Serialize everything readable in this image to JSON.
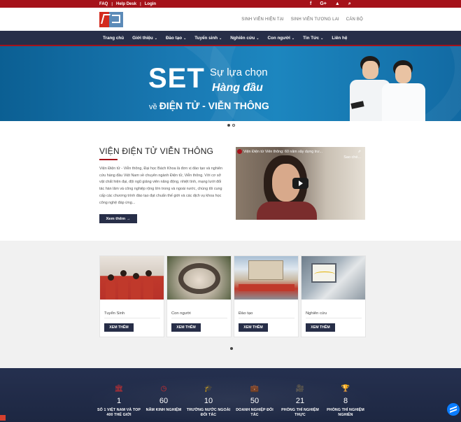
{
  "topbar": {
    "links": [
      "FAQ",
      "Help Desk",
      "Login"
    ],
    "separator": "|",
    "social_icons": [
      "facebook-icon",
      "google-plus-icon",
      "user-icon",
      "search-icon"
    ],
    "social_glyphs": [
      "f",
      "G+",
      "▲",
      "⌕"
    ]
  },
  "header": {
    "nav": [
      "SINH VIÊN HIỆN TẠI",
      "SINH VIÊN TƯƠNG LAI",
      "CÁN BỘ"
    ]
  },
  "mainnav": {
    "items": [
      {
        "label": "Trang chủ",
        "dropdown": false
      },
      {
        "label": "Giới thiệu",
        "dropdown": true
      },
      {
        "label": "Đào tạo",
        "dropdown": true
      },
      {
        "label": "Tuyển sinh",
        "dropdown": true
      },
      {
        "label": "Nghiên cứu",
        "dropdown": true
      },
      {
        "label": "Con người",
        "dropdown": true
      },
      {
        "label": "Tin Tức",
        "dropdown": true
      },
      {
        "label": "Liên hệ",
        "dropdown": false
      }
    ],
    "caret": "⌄"
  },
  "hero": {
    "set": "SET",
    "choice": "Sự lựa chọn",
    "top": "Hàng đầu",
    "ve": "về",
    "field": "ĐIỆN TỬ - VIỄN THÔNG",
    "slides": 2,
    "active_slide": 0
  },
  "about": {
    "title": "VIỆN ĐIỆN TỬ VIỄN THÔNG",
    "text": "Viện Điện tử - Viễn thông, Đại học Bách Khoa là đơn vị đào tạo và nghiên cứu hàng đầu Việt Nam về chuyên ngành Điện tử, Viễn thông. Với cơ sở vật chất hiện đại, đội ngũ giảng viên năng động, nhiệt tình, mạng lưới đối tác hàn lâm và công nghiệp rộng lớn trong và ngoài nước, chúng tôi cung cấp các chương trình đào tạo đạt chuẩn thế giới và các dịch vụ khoa học công nghệ đáp ứng...",
    "button": "Xem thêm →",
    "video": {
      "title": "Viện Điện tử Viễn thông: 60 năm xây dựng trư...",
      "share": "⇗",
      "share_label": "Sao ché..."
    }
  },
  "cards": [
    {
      "category": "Tuyển Sinh",
      "button": "XEM THÊM"
    },
    {
      "category": "Con người",
      "button": "XEM THÊM"
    },
    {
      "category": "Đào tạo",
      "button": "XEM THÊM"
    },
    {
      "category": "Nghiên cứu",
      "button": "XEM THÊM"
    }
  ],
  "stats": [
    {
      "icon": "building-icon",
      "glyph": "🏛",
      "number": "1",
      "label": "SỐ 1 VIỆT NAM VÀ TOP 400 THẾ GIỚI"
    },
    {
      "icon": "clock-icon",
      "glyph": "◷",
      "number": "60",
      "label": "NĂM KINH NGHIỆM"
    },
    {
      "icon": "graduation-cap-icon",
      "glyph": "🎓",
      "number": "10",
      "label": "TRƯỜNG NƯỚC NGOÀI ĐỐI TÁC"
    },
    {
      "icon": "briefcase-icon",
      "glyph": "💼",
      "number": "50",
      "label": "DOANH NGHIỆP ĐỐI TÁC"
    },
    {
      "icon": "video-camera-icon",
      "glyph": "🎥",
      "number": "21",
      "label": "PHÒNG THÍ NGHIỆM THỰC"
    },
    {
      "icon": "trophy-icon",
      "glyph": "🏆",
      "number": "8",
      "label": "PHÒNG THÍ NGHIỆM NGHIÊN"
    }
  ],
  "colors": {
    "brand_red": "#a5121a",
    "navy": "#272e48",
    "hero_blue": "#1a7ab4",
    "stat_icon_red": "#d62f2f"
  }
}
